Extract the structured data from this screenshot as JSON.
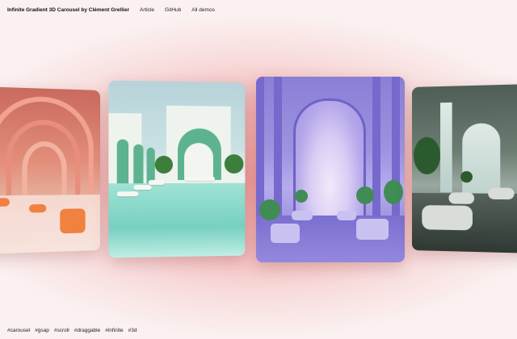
{
  "header": {
    "title": "Infinite Gradient 3D Carousel by Clément Grellier",
    "links": [
      "Article",
      "GitHub",
      "All demos"
    ]
  },
  "carousel": {
    "slides": [
      {
        "name": "red-arches-lounge"
      },
      {
        "name": "mint-pool-courtyard"
      },
      {
        "name": "purple-arched-hall"
      },
      {
        "name": "green-panoramic-lounge"
      }
    ]
  },
  "tags": [
    "#carousel",
    "#gsap",
    "#scroll",
    "#draggable",
    "#infinite",
    "#3d"
  ],
  "colors": {
    "background_center": "#ee9d9d",
    "background_edge": "#fbf1f1",
    "text": "#111111"
  }
}
